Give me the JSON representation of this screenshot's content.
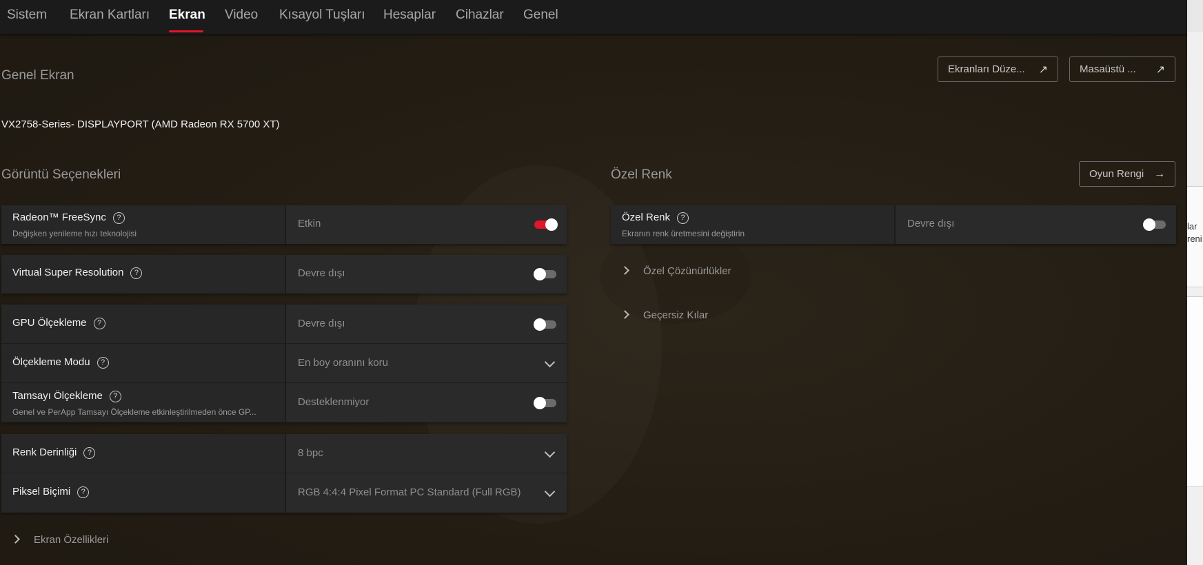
{
  "nav": {
    "tabs": [
      {
        "label": "Sistem"
      },
      {
        "label": "Ekran Kartları"
      },
      {
        "label": "Ekran"
      },
      {
        "label": "Video"
      },
      {
        "label": "Kısayol Tuşları"
      },
      {
        "label": "Hesaplar"
      },
      {
        "label": "Cihazlar"
      },
      {
        "label": "Genel"
      }
    ],
    "active": "Ekran"
  },
  "header": {
    "title": "Genel Ekran",
    "btn_arrange": "Ekranları Düze...",
    "btn_desktop": "Masaüstü ..."
  },
  "display_name": "VX2758-Series- DISPLAYPORT (AMD Radeon RX 5700 XT)",
  "left": {
    "title": "Görüntü Seçenekleri",
    "freesync": {
      "label": "Radeon™ FreeSync",
      "sub": "Değişken yenileme hızı teknolojisi",
      "value": "Etkin",
      "enabled": true
    },
    "vsr": {
      "label": "Virtual Super Resolution",
      "value": "Devre dışı",
      "enabled": false
    },
    "gpu_scaling": {
      "label": "GPU Ölçekleme",
      "value": "Devre dışı",
      "enabled": false
    },
    "scaling_mode": {
      "label": "Ölçekleme Modu",
      "value": "En boy oranını koru"
    },
    "integer_scaling": {
      "label": "Tamsayı Ölçekleme",
      "sub": "Genel ve PerApp Tamsayı Ölçekleme etkinleştirilmeden önce GP...",
      "value": "Desteklenmiyor",
      "enabled": false
    },
    "color_depth": {
      "label": "Renk Derinliği",
      "value": "8 bpc"
    },
    "pixel_format": {
      "label": "Piksel Biçimi",
      "value": "RGB 4:4:4 Pixel Format PC Standard (Full RGB)"
    },
    "expander_props": "Ekran Özellikleri"
  },
  "right": {
    "title": "Özel Renk",
    "btn_game_color": "Oyun Rengi",
    "custom_color": {
      "label": "Özel Renk",
      "sub": "Ekranın renk üretmesini değiştirin",
      "value": "Devre dışı",
      "enabled": false
    },
    "expander_res": "Özel Çözünürlükler",
    "expander_override": "Geçersiz Kılar"
  },
  "side_strip": {
    "line1": "lar",
    "line2": "reni"
  },
  "colors": {
    "accent": "#e0162b",
    "background": "#231d14",
    "card": "#272727"
  },
  "icons": [
    "help-icon",
    "external-link-icon",
    "arrow-right-icon",
    "chevron-down-icon",
    "chevron-right-icon"
  ]
}
